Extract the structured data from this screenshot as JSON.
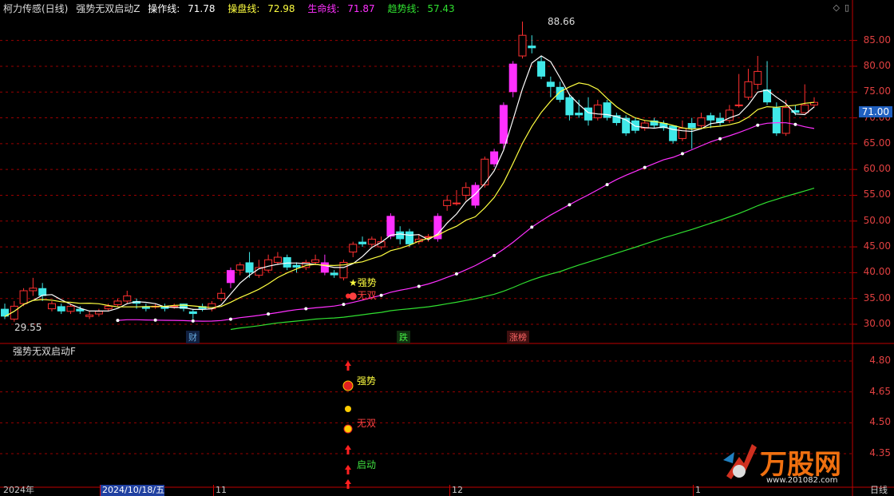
{
  "header": {
    "stock_name": "柯力传感(日线)",
    "indicator_name": "强势无双启动Z",
    "op_label": "操作线:",
    "op_value": "71.78",
    "pan_label": "操盘线:",
    "pan_value": "72.98",
    "life_label": "生命线:",
    "life_value": "71.87",
    "trend_label": "趋势线:",
    "trend_value": "57.43"
  },
  "lower_panel": {
    "title": "强势无双启动F"
  },
  "annotations": {
    "high_price": "88.66",
    "low_price": "29.55",
    "tag_cai": "财",
    "tag_die": "跌",
    "tag_zhangting": "涨榜",
    "sig_qiangshi": "强势",
    "sig_wushuang": "无双",
    "sig_qidong": "启动",
    "lower_qiangshi": "强势",
    "lower_wushuang": "无双",
    "lower_qidong": "启动"
  },
  "price_axis": [
    "85.00",
    "80.00",
    "75.00",
    "70.00",
    "65.00",
    "60.00",
    "55.00",
    "50.00",
    "45.00",
    "40.00",
    "35.00",
    "30.00"
  ],
  "current_price": "71.00",
  "lower_axis": [
    "4.80",
    "4.65",
    "4.50",
    "4.35"
  ],
  "dates": {
    "year": "2024年",
    "cursor": "2024/10/18/五",
    "m11": "11",
    "m12": "12",
    "m1": "1",
    "period": "日线"
  },
  "watermark": {
    "brand": "万股网",
    "url": "www.201082.com"
  },
  "colors": {
    "up": "#ff3030",
    "down": "#40e8e8",
    "limit_up": "#ff30ff",
    "op_line": "#ffffff",
    "pan_line": "#ffff40",
    "life_line": "#ff30ff",
    "trend_line": "#30e030",
    "grid": "#c00000"
  },
  "chart_data": {
    "type": "candlestick",
    "ylim": [
      27,
      89
    ],
    "candles": [
      [
        33.0,
        31.5,
        34.0,
        31.0
      ],
      [
        31.0,
        33.5,
        34.5,
        30.5
      ],
      [
        34.0,
        36.5,
        37.0,
        33.5
      ],
      [
        36.5,
        37.0,
        39.0,
        35.5
      ],
      [
        37.0,
        35.5,
        38.0,
        34.5
      ],
      [
        33.0,
        34.0,
        34.5,
        32.5
      ],
      [
        33.5,
        32.5,
        34.0,
        32.0
      ],
      [
        32.5,
        33.5,
        34.0,
        32.0
      ],
      [
        33.0,
        32.5,
        33.5,
        32.0
      ],
      [
        31.5,
        31.8,
        32.5,
        31.0
      ],
      [
        32.0,
        32.5,
        33.0,
        31.5
      ],
      [
        33.0,
        33.5,
        34.0,
        32.5
      ],
      [
        33.8,
        34.5,
        35.0,
        33.5
      ],
      [
        34.5,
        35.5,
        36.5,
        34.0
      ],
      [
        34.5,
        34.0,
        35.0,
        33.0
      ],
      [
        33.5,
        33.0,
        34.0,
        32.5
      ],
      [
        33.5,
        33.5,
        34.0,
        33.0
      ],
      [
        33.5,
        33.0,
        34.0,
        32.5
      ],
      [
        33.5,
        33.5,
        34.0,
        33.0
      ],
      [
        34.0,
        33.0,
        34.0,
        32.5
      ],
      [
        32.5,
        32.0,
        33.0,
        31.0
      ],
      [
        33.5,
        33.0,
        34.0,
        32.5
      ],
      [
        33.0,
        34.0,
        34.5,
        32.5
      ],
      [
        35.0,
        36.0,
        37.0,
        34.5
      ],
      [
        38.0,
        40.5,
        41.0,
        37.0
      ],
      [
        40.5,
        41.5,
        42.0,
        39.5
      ],
      [
        42.0,
        40.0,
        44.0,
        39.0
      ],
      [
        39.5,
        41.0,
        42.5,
        39.0
      ],
      [
        40.5,
        42.5,
        43.5,
        40.0
      ],
      [
        42.0,
        43.0,
        44.0,
        41.5
      ],
      [
        43.0,
        41.0,
        43.5,
        40.5
      ],
      [
        41.5,
        41.0,
        42.0,
        40.0
      ],
      [
        41.0,
        42.0,
        42.5,
        40.5
      ],
      [
        42.0,
        42.5,
        43.5,
        41.5
      ],
      [
        42.0,
        40.0,
        43.5,
        39.5
      ],
      [
        40.0,
        39.5,
        40.5,
        39.0
      ],
      [
        39.0,
        42.0,
        42.5,
        38.5
      ],
      [
        44.0,
        45.5,
        46.0,
        43.0
      ],
      [
        46.0,
        45.5,
        47.0,
        45.0
      ],
      [
        45.5,
        46.5,
        47.0,
        45.0
      ],
      [
        45.0,
        46.0,
        47.0,
        44.5
      ],
      [
        47.0,
        51.0,
        51.5,
        46.5
      ],
      [
        48.0,
        46.5,
        49.0,
        45.5
      ],
      [
        48.0,
        45.5,
        48.5,
        45.0
      ],
      [
        46.0,
        46.5,
        47.5,
        45.5
      ],
      [
        47.0,
        47.0,
        47.5,
        46.0
      ],
      [
        46.5,
        51.0,
        51.5,
        46.0
      ],
      [
        53.0,
        54.0,
        55.0,
        52.0
      ],
      [
        53.5,
        53.5,
        56.0,
        53.0
      ],
      [
        55.0,
        56.5,
        57.5,
        54.0
      ],
      [
        53.0,
        57.0,
        57.5,
        52.5
      ],
      [
        57.0,
        62.0,
        62.5,
        56.5
      ],
      [
        61.0,
        63.5,
        64.0,
        60.5
      ],
      [
        65.0,
        72.5,
        73.0,
        64.0
      ],
      [
        75.0,
        80.5,
        81.0,
        74.0
      ],
      [
        82.0,
        86.0,
        88.66,
        81.5
      ],
      [
        84.0,
        83.5,
        86.0,
        82.5
      ],
      [
        81.0,
        78.0,
        82.0,
        77.5
      ],
      [
        77.0,
        76.0,
        78.0,
        74.0
      ],
      [
        76.0,
        73.5,
        77.0,
        73.0
      ],
      [
        74.0,
        70.5,
        74.5,
        69.5
      ],
      [
        71.0,
        70.5,
        73.5,
        70.0
      ],
      [
        72.0,
        69.5,
        74.0,
        68.5
      ],
      [
        70.0,
        72.5,
        73.5,
        69.5
      ],
      [
        73.0,
        70.0,
        73.5,
        69.5
      ],
      [
        70.5,
        69.0,
        71.0,
        68.5
      ],
      [
        70.0,
        67.0,
        70.5,
        66.5
      ],
      [
        69.5,
        67.5,
        70.0,
        67.0
      ],
      [
        68.0,
        69.0,
        69.5,
        67.5
      ],
      [
        69.5,
        68.5,
        70.0,
        68.0
      ],
      [
        69.0,
        68.0,
        69.5,
        67.5
      ],
      [
        68.5,
        65.5,
        68.5,
        65.0
      ],
      [
        66.0,
        68.0,
        69.5,
        65.5
      ],
      [
        69.0,
        68.0,
        70.0,
        64.0
      ],
      [
        68.5,
        70.0,
        71.0,
        68.0
      ],
      [
        70.5,
        69.5,
        71.0,
        68.0
      ],
      [
        70.0,
        69.0,
        71.0,
        68.5
      ],
      [
        69.5,
        71.5,
        72.5,
        69.0
      ],
      [
        72.5,
        72.5,
        78.5,
        72.0
      ],
      [
        74.0,
        77.0,
        79.5,
        73.5
      ],
      [
        76.5,
        79.0,
        82.0,
        75.5
      ],
      [
        75.5,
        73.0,
        81.0,
        72.5
      ],
      [
        72.0,
        67.0,
        73.0,
        66.5
      ],
      [
        67.0,
        72.0,
        73.5,
        66.5
      ],
      [
        71.5,
        71.0,
        72.5,
        70.5
      ],
      [
        71.0,
        72.5,
        76.5,
        71.0
      ],
      [
        72.5,
        73.0,
        74.0,
        72.0
      ]
    ],
    "limit_up_indices": [
      24,
      34,
      41,
      46,
      50,
      52,
      53,
      54
    ]
  }
}
